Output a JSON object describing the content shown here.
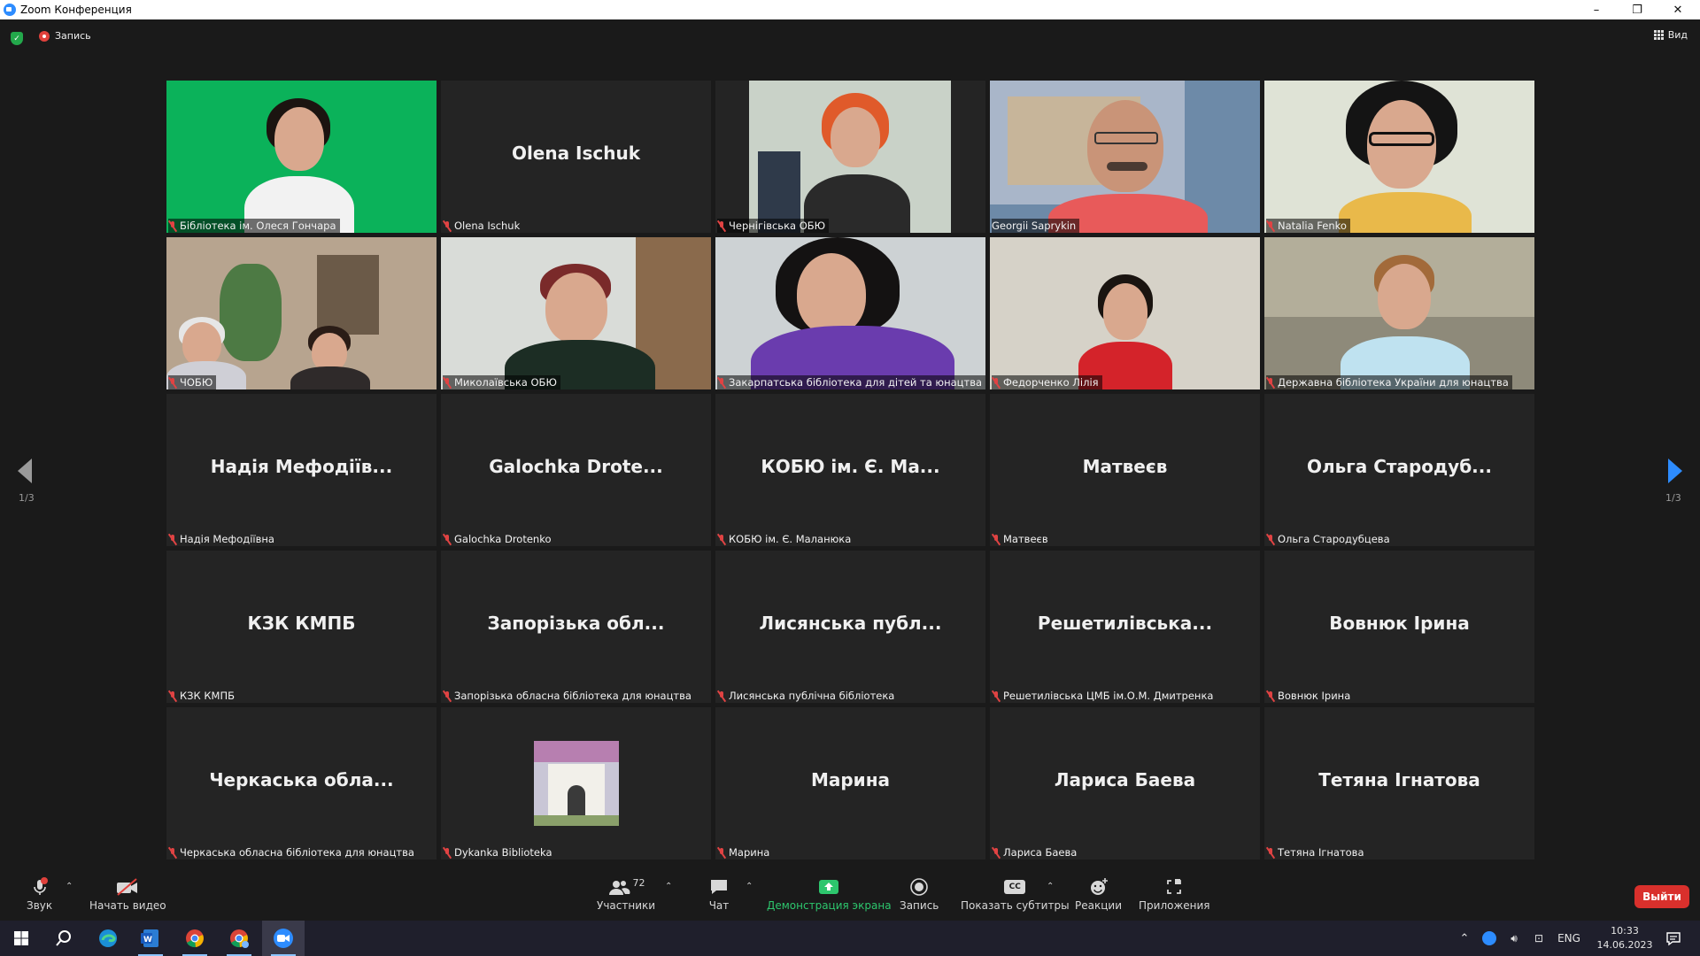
{
  "window": {
    "title": "Zoom Конференция",
    "controls": {
      "minimize": "–",
      "restore": "❐",
      "close": "✕"
    }
  },
  "topbar": {
    "security_icon": "shield-check-icon",
    "recording_label": "Запись",
    "view_label": "Вид"
  },
  "pagination": {
    "left": "1/3",
    "right": "1/3"
  },
  "tiles": [
    {
      "big": "",
      "label": "Бібліотека ім. Олеся Гончара"
    },
    {
      "big": "Olena Ischuk",
      "label": "Olena Ischuk"
    },
    {
      "big": "",
      "label": "Чернігівська ОБЮ"
    },
    {
      "big": "",
      "label": "Georgii Saprykin"
    },
    {
      "big": "",
      "label": "Natalia Fenko"
    },
    {
      "big": "",
      "label": "ЧОБЮ"
    },
    {
      "big": "",
      "label": "Миколаївська ОБЮ"
    },
    {
      "big": "",
      "label": "Закарпатська бібліотека для дітей та юнацтва"
    },
    {
      "big": "",
      "label": "Федорченко Лілія"
    },
    {
      "big": "",
      "label": "Державна бібліотека України для юнацтва"
    },
    {
      "big": "Надія Мефодіїв...",
      "label": "Надія Мефодіївна"
    },
    {
      "big": "Galochka  Drote...",
      "label": "Galochka  Drotenko"
    },
    {
      "big": "КОБЮ ім. Є. Ма...",
      "label": "КОБЮ ім. Є. Маланюка"
    },
    {
      "big": "Матвеєв",
      "label": "Матвеєв"
    },
    {
      "big": "Ольга Стародуб...",
      "label": "Ольга Стародубцева"
    },
    {
      "big": "КЗК КМПБ",
      "label": "КЗК КМПБ"
    },
    {
      "big": "Запорізька обл...",
      "label": "Запорізька обласна бібліотека для юнацтва"
    },
    {
      "big": "Лисянська публ...",
      "label": "Лисянська публічна бібліотека"
    },
    {
      "big": "Решетилівська...",
      "label": "Решетилівська ЦМБ ім.О.М. Дмитренка"
    },
    {
      "big": "Вовнюк Ірина",
      "label": "Вовнюк Ірина"
    },
    {
      "big": "Черкаська обла...",
      "label": "Черкаська обласна бібліотека для юнацтва"
    },
    {
      "big": "",
      "label": "Dykanka Biblioteka"
    },
    {
      "big": "Марина",
      "label": "Марина"
    },
    {
      "big": "Лариса Баева",
      "label": "Лариса Баева"
    },
    {
      "big": "Тетяна Ігнатова",
      "label": "Тетяна Ігнатова"
    }
  ],
  "controls": {
    "audio": "Звук",
    "video": "Начать видео",
    "participants": "Участники",
    "participants_count": "72",
    "chat": "Чат",
    "share": "Демонстрация экрана",
    "record": "Запись",
    "captions": "Показать субтитры",
    "captions_badge": "CC",
    "reactions": "Реакции",
    "apps": "Приложения",
    "leave": "Выйти"
  },
  "taskbar": {
    "language": "ENG",
    "time": "10:33",
    "date": "14.06.2023"
  },
  "colors": {
    "active_speaker": "#f2e16a",
    "share_green": "#2dc66d",
    "leave_red": "#d9302c",
    "zoom_blue": "#2d8cff",
    "muted_red": "#e04343"
  }
}
